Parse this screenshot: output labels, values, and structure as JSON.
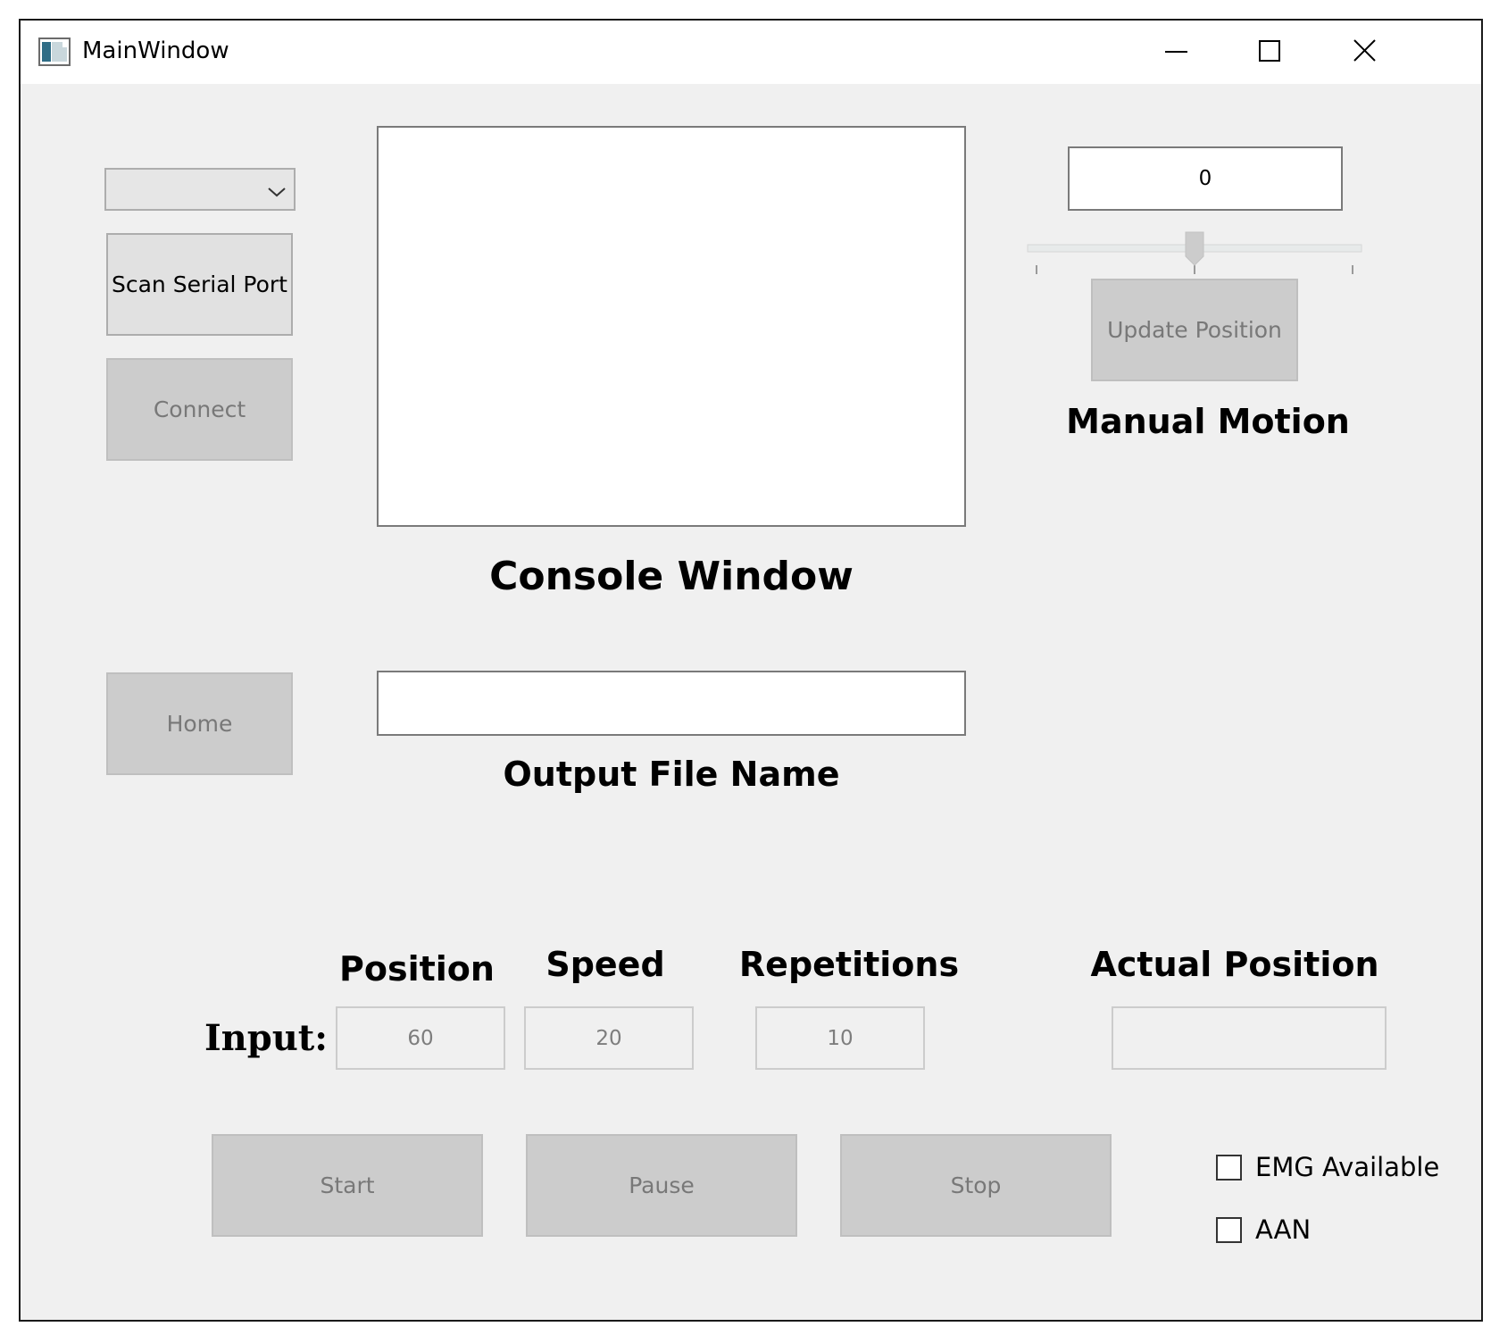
{
  "window": {
    "title": "MainWindow",
    "icons": {
      "app": "app-window-icon",
      "minimize": "minimize-icon",
      "maximize": "maximize-icon",
      "close": "close-icon"
    }
  },
  "serial": {
    "port_select_value": "",
    "dropdown_icon": "chevron-down-icon",
    "scan_label": "Scan Serial Port",
    "connect_label": "Connect",
    "home_label": "Home"
  },
  "console": {
    "content": "",
    "label": "Console Window"
  },
  "output_file": {
    "value": "",
    "label": "Output File Name"
  },
  "manual_motion": {
    "value": "0",
    "slider_level": 0.5,
    "update_label": "Update Position",
    "label": "Manual Motion"
  },
  "inputs": {
    "row_label": "Input:",
    "position_header": "Position",
    "speed_header": "Speed",
    "repetitions_header": "Repetitions",
    "position_value": "60",
    "speed_value": "20",
    "repetitions_value": "10"
  },
  "actual_position": {
    "header": "Actual Position",
    "value": ""
  },
  "controls": {
    "start_label": "Start",
    "pause_label": "Pause",
    "stop_label": "Stop"
  },
  "options": {
    "emg_label": "EMG Available",
    "emg_checked": false,
    "aan_label": "AAN",
    "aan_checked": false
  }
}
